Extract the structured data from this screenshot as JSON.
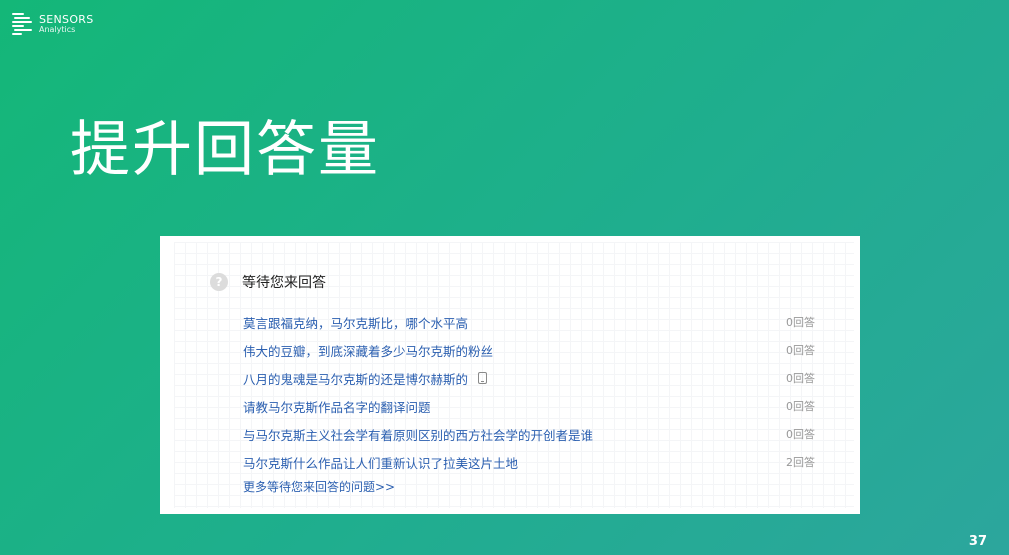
{
  "brand": {
    "name": "SENSORS",
    "sub": "Analytics"
  },
  "slide": {
    "title": "提升回答量",
    "page_number": "37"
  },
  "panel": {
    "title": "等待您来回答",
    "questions": [
      {
        "text": "莫言跟福克纳，马尔克斯比，哪个水平高",
        "answers": "0回答",
        "icon": ""
      },
      {
        "text": "伟大的豆瓣，到底深藏着多少马尔克斯的粉丝",
        "answers": "0回答",
        "icon": ""
      },
      {
        "text": "八月的鬼魂是马尔克斯的还是博尔赫斯的",
        "answers": "0回答",
        "icon": "mobile-phone-icon"
      },
      {
        "text": "请教马尔克斯作品名字的翻译问题",
        "answers": "0回答",
        "icon": ""
      },
      {
        "text": "与马尔克斯主义社会学有着原则区别的西方社会学的开创者是谁",
        "answers": "0回答",
        "icon": ""
      },
      {
        "text": "马尔克斯什么作品让人们重新认识了拉美这片土地",
        "answers": "2回答",
        "icon": ""
      }
    ],
    "more_link": "更多等待您来回答的问题>>"
  }
}
